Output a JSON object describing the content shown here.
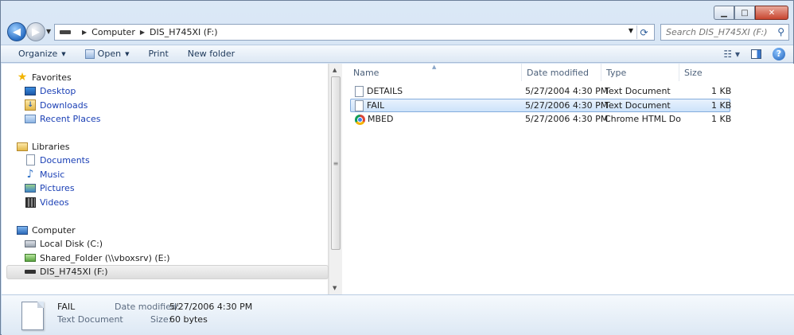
{
  "window": {
    "controls": {
      "minimize": "▁",
      "maximize": "□",
      "close": "✕"
    }
  },
  "navbar": {
    "back": "◀",
    "forward": "▶",
    "breadcrumbs": [
      "Computer",
      "DIS_H745XI (F:)"
    ],
    "search_placeholder": "Search DIS_H745XI (F:)"
  },
  "toolbar": {
    "organize": "Organize",
    "open": "Open",
    "print": "Print",
    "new_folder": "New folder",
    "help": "?"
  },
  "sidebar": {
    "favorites_label": "Favorites",
    "favorites": [
      "Desktop",
      "Downloads",
      "Recent Places"
    ],
    "libraries_label": "Libraries",
    "libraries": [
      "Documents",
      "Music",
      "Pictures",
      "Videos"
    ],
    "computer_label": "Computer",
    "drives": [
      "Local Disk (C:)",
      "Shared_Folder (\\\\vboxsrv) (E:)",
      "DIS_H745XI (F:)"
    ]
  },
  "columns": {
    "name": "Name",
    "date": "Date modified",
    "type": "Type",
    "size": "Size"
  },
  "files": [
    {
      "name": "DETAILS",
      "date": "5/27/2004 4:30 PM",
      "type": "Text Document",
      "size": "1 KB",
      "icon": "text-file-icon"
    },
    {
      "name": "FAIL",
      "date": "5/27/2006 4:30 PM",
      "type": "Text Document",
      "size": "1 KB",
      "icon": "text-file-icon",
      "selected": true
    },
    {
      "name": "MBED",
      "date": "5/27/2006 4:30 PM",
      "type": "Chrome HTML Do...",
      "size": "1 KB",
      "icon": "chrome-icon"
    }
  ],
  "details_pane": {
    "name": "FAIL",
    "type": "Text Document",
    "date_label": "Date modified:",
    "date_value": "5/27/2006 4:30 PM",
    "size_label": "Size:",
    "size_value": "60 bytes"
  }
}
